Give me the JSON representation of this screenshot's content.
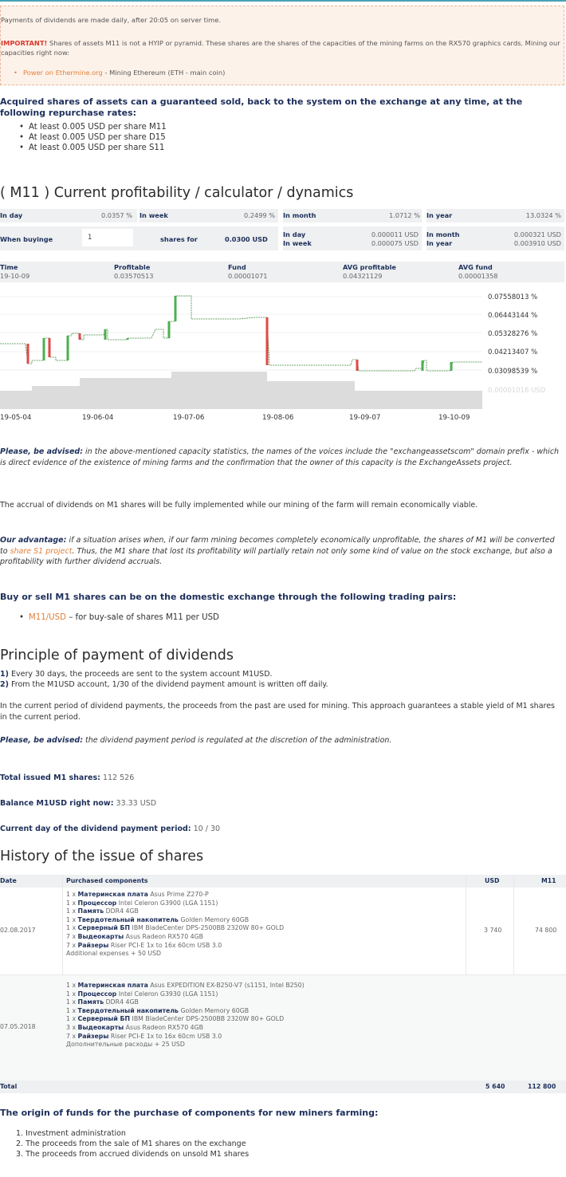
{
  "notice": {
    "line1": "Payments of dividends are made daily, after 20:05 on server time.",
    "important_label": "IMPORTANT!",
    "important_text": "Shares of assets M11 is not a HYIP or pyramid. These shares are the shares of the capacities of the mining farms on the RX570 graphics cards. Mining our capacities right now:",
    "pool_link": "Power on Ethermine.org",
    "pool_text": "- Mining Ethereum (ETH - main coin)"
  },
  "repurchase": {
    "heading": "Acquired shares of assets can a guaranteed sold, back to the system on the exchange at any time, at the following repurchase rates:",
    "items": [
      "At least 0.005 USD per share M11",
      "At least 0.005 USD per share D15",
      "At least 0.005 USD per share S11"
    ]
  },
  "calc": {
    "title": "( M11 ) Current profitability / calculator / dynamics",
    "row1": [
      {
        "label": "In day",
        "value": "0.0357 %"
      },
      {
        "label": "In week",
        "value": "0.2499 %"
      },
      {
        "label": "In month",
        "value": "1.0712 %"
      },
      {
        "label": "In year",
        "value": "13.0324 %"
      }
    ],
    "buy_label": "When buyinge",
    "buy_value": "1",
    "shares_for": "shares for",
    "price": "0.0300 USD",
    "est_day_label": "In day",
    "est_week_label": "In week",
    "est_day": "0.000011 USD",
    "est_week": "0.000075 USD",
    "est_month_label": "In month",
    "est_year_label": "In year",
    "est_month": "0.000321 USD",
    "est_year": "0.003910 USD",
    "info": [
      {
        "label": "Time",
        "value": "19-10-09"
      },
      {
        "label": "Profitable",
        "value": "0.03570513"
      },
      {
        "label": "Fund",
        "value": "0.00001071"
      },
      {
        "label": "AVG profitable",
        "value": "0.04321129"
      },
      {
        "label": "AVG fund",
        "value": "0.00001358"
      }
    ]
  },
  "chart_data": {
    "type": "line",
    "x_ticks": [
      "19-05-04",
      "19-06-04",
      "19-07-06",
      "19-08-06",
      "19-09-07",
      "19-10-09"
    ],
    "y_ticks": [
      "0.07558013 %",
      "0.06443144 %",
      "0.05328276 %",
      "0.04213407 %",
      "0.03098539 %"
    ],
    "fund_tick": "0.00001016 USD",
    "colors": {
      "up": "#4caf50",
      "down": "#e04848",
      "line": "#3f8a3f",
      "fund": "#dcdcdc"
    }
  },
  "advised1": {
    "lead": "Please, be advised:",
    "text": "in the above-mentioned capacity statistics, the names of the voices include the \"exchangeassetscom\" domain prefix - which is direct evidence of the existence of mining farms and the confirmation that the owner of this capacity is the ExchangeAssets project."
  },
  "accrual": "The accrual of dividends on M1 shares will be fully implemented while our mining of the farm will remain economically viable.",
  "advantage": {
    "lead": "Our advantage:",
    "text1": "if a situation arises when, if our farm mining becomes completely economically unprofitable, the shares of M1 will be converted to",
    "link": "share S1 project",
    "text2": ". Thus, the M1 share that lost its profitability will partially retain not only some kind of value on the stock exchange, but also a profitability with further dividend accruals."
  },
  "trading": {
    "heading": "Buy or sell M1 shares can be on the domestic exchange through the following trading pairs:",
    "pair": "M11/USD",
    "pair_text": "– for buy-sale of shares M11 per USD"
  },
  "principle": {
    "title": "Principle of payment of dividends",
    "step1_num": "1)",
    "step1": "Every 30 days, the proceeds are sent to the system account M1USD.",
    "step2_num": "2)",
    "step2": "From the M1USD account, 1/30 of the dividend payment amount is written off daily.",
    "para": "In the current period of dividend payments, the proceeds from the past are used for mining. This approach guarantees a stable yield of M1 shares in the current period.",
    "advised_lead": "Please, be advised:",
    "advised_text": "the dividend payment period is regulated at the discretion of the administration.",
    "total_label": "Total issued M1 shares:",
    "total_value": "112 526",
    "balance_label": "Balance M1USD right now:",
    "balance_value": "33.33 USD",
    "day_label": "Current day of the dividend payment period:",
    "day_value": "10 / 30"
  },
  "history": {
    "title": "History of the issue of shares",
    "headers": [
      "Date",
      "Purchased components",
      "USD",
      "M11"
    ],
    "rows": [
      {
        "date": "02.08.2017",
        "usd": "3 740",
        "m11": "74 800",
        "items": [
          {
            "q": "1 x",
            "b": "Материнская плата",
            "t": "Asus Prime Z270-P"
          },
          {
            "q": "1 x",
            "b": "Процессор",
            "t": "Intel Celeron G3900 (LGA 1151)"
          },
          {
            "q": "1 x",
            "b": "Память",
            "t": "DDR4 4GB"
          },
          {
            "q": "1 x",
            "b": "Твердотельный накопитель",
            "t": "Golden Memory 60GB"
          },
          {
            "q": "1 x",
            "b": "Серверный БП",
            "t": "IBM BladeCenter DPS-2500BB 2320W 80+ GOLD"
          },
          {
            "q": "7 x",
            "b": "Выдеокарты",
            "t": "Asus Radeon RX570 4GB"
          },
          {
            "q": "7 x",
            "b": "Райзеры",
            "t": "Riser PCI-E 1x to 16x 60cm USB 3.0"
          },
          {
            "q": "",
            "b": "",
            "t": "Additional expenses + 50 USD"
          }
        ]
      },
      {
        "date": "07.05.2018",
        "usd": "",
        "m11": "",
        "items": [
          {
            "q": "1 x",
            "b": "Материнская плата",
            "t": "Asus EXPEDITION EX-B250-V7 (s1151, Intel B250)"
          },
          {
            "q": "1 x",
            "b": "Процессор",
            "t": "Intel Celeron G3930 (LGA 1151)"
          },
          {
            "q": "1 x",
            "b": "Память",
            "t": "DDR4 4GB"
          },
          {
            "q": "1 x",
            "b": "Твердотельный накопитель",
            "t": "Golden Memory 60GB"
          },
          {
            "q": "1 x",
            "b": "Серверный БП",
            "t": "IBM BladeCenter DPS-2500BB 2320W 80+ GOLD"
          },
          {
            "q": "3 x",
            "b": "Выдеокарты",
            "t": "Asus Radeon RX570 4GB"
          },
          {
            "q": "7 x",
            "b": "Райзеры",
            "t": "Riser PCI-E 1x to 16x 60cm USB 3.0"
          },
          {
            "q": "",
            "b": "",
            "t": "Дополнительные расходы + 25 USD"
          }
        ]
      }
    ],
    "total_label": "Total",
    "total_usd": "5 640",
    "total_m11": "112 800"
  },
  "origin": {
    "heading": "The origin of funds for the purchase of components for new miners farming:",
    "items": [
      "1. Investment administration",
      "2. The proceeds from the sale of M1 shares on the exchange",
      "3. The proceeds from accrued dividends on unsold M1 shares"
    ]
  }
}
